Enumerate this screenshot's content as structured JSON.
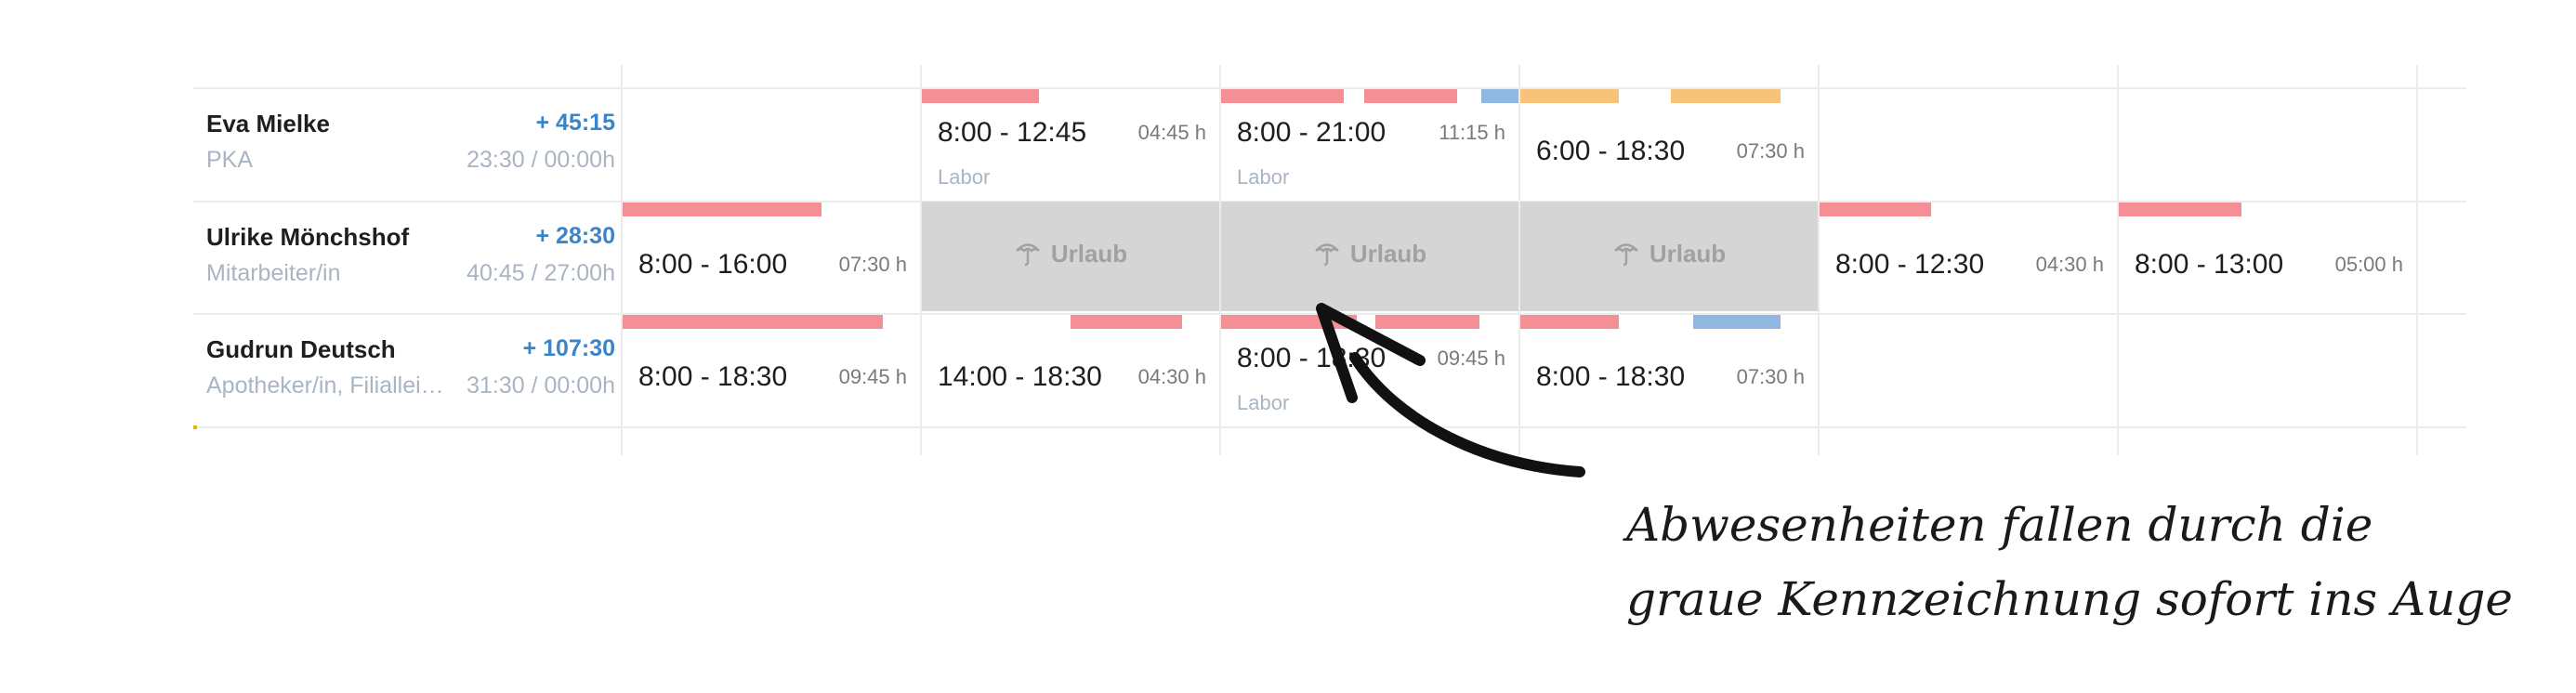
{
  "employees": [
    {
      "name": "Eva Mielke",
      "balance": "+ 45:15",
      "role": "PKA",
      "hours": "23:30 / 00:00h"
    },
    {
      "name": "Ulrike Mönchshof",
      "balance": "+ 28:30",
      "role": "Mitarbeiter/in",
      "hours": "40:45 / 27:00h"
    },
    {
      "name": "Gudrun Deutsch",
      "balance": "+ 107:30",
      "role": "Apotheker/in, Filialleitung",
      "hours": "31:30 / 00:00h"
    }
  ],
  "shifts": {
    "eva_d2": {
      "time": "8:00 - 12:45",
      "duration": "04:45 h",
      "label": "Labor"
    },
    "eva_d3": {
      "time": "8:00 - 21:00",
      "duration": "11:15 h",
      "label": "Labor"
    },
    "eva_d4": {
      "time": "6:00 - 18:30",
      "duration": "07:30 h"
    },
    "ulrike_d1": {
      "time": "8:00 - 16:00",
      "duration": "07:30 h"
    },
    "ulrike_d5": {
      "time": "8:00 - 12:30",
      "duration": "04:30 h"
    },
    "ulrike_d6": {
      "time": "8:00 - 13:00",
      "duration": "05:00 h"
    },
    "gudrun_d1": {
      "time": "8:00 - 18:30",
      "duration": "09:45 h"
    },
    "gudrun_d2": {
      "time": "14:00 - 18:30",
      "duration": "04:30 h"
    },
    "gudrun_d3": {
      "time": "8:00 - 18:30",
      "duration": "09:45 h",
      "label": "Labor"
    },
    "gudrun_d4": {
      "time": "8:00 - 18:30",
      "duration": "07:30 h"
    }
  },
  "absence": {
    "label": "Urlaub",
    "icon": "umbrella-icon"
  },
  "annotation": {
    "line1": "Abwesenheiten fallen durch die",
    "line2": "graue Kennzeichnung sofort ins Auge"
  },
  "colors": {
    "red": "#f58f96",
    "blue": "#8fb7e0",
    "orange": "#f7c37a",
    "absence": "#d5d5d5",
    "balance": "#3c84c8"
  }
}
